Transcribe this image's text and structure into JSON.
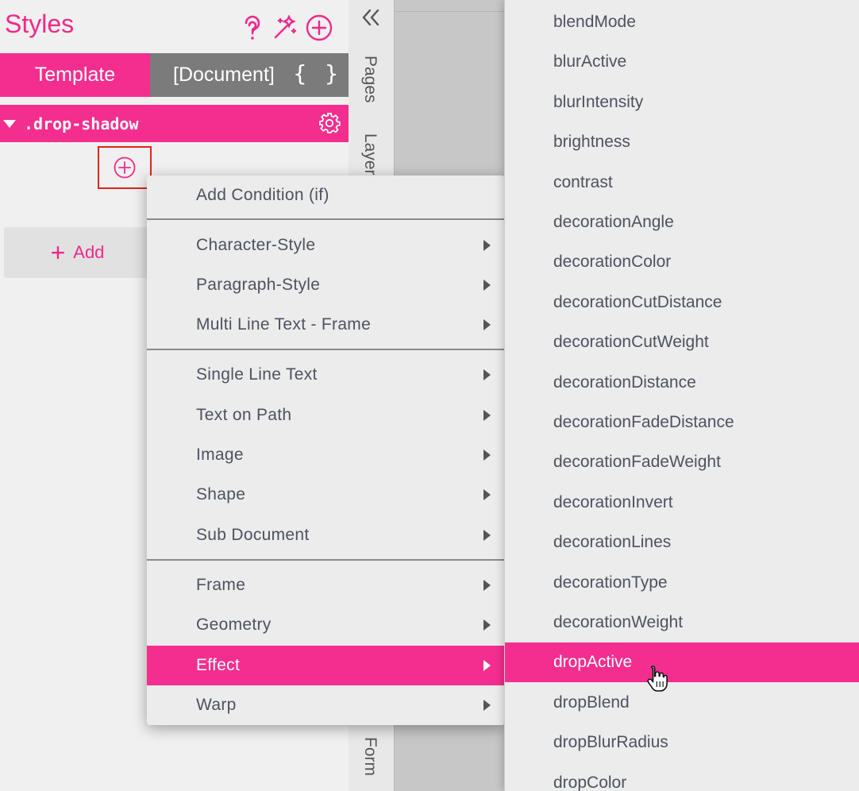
{
  "panel": {
    "title": "Styles",
    "header_icons": [
      "help-icon",
      "magic-wand-icon",
      "add-circle-icon"
    ],
    "tabs": [
      {
        "label": "Template",
        "active": true
      },
      {
        "label": "[Document]",
        "active": false
      }
    ],
    "braces_label": "{ }",
    "style_name": ".drop-shadow",
    "add_label": "Add"
  },
  "side_tabs": [
    "Pages",
    "Layers",
    "Form"
  ],
  "context_menu": {
    "items": [
      {
        "label": "Add Condition (if)",
        "submenu": false
      },
      {
        "label": "Character-Style",
        "submenu": true
      },
      {
        "label": "Paragraph-Style",
        "submenu": true
      },
      {
        "label": "Multi Line Text - Frame",
        "submenu": true
      },
      {
        "label": "Single Line Text",
        "submenu": true
      },
      {
        "label": "Text on Path",
        "submenu": true
      },
      {
        "label": "Image",
        "submenu": true
      },
      {
        "label": "Shape",
        "submenu": true
      },
      {
        "label": "Sub Document",
        "submenu": true
      },
      {
        "label": "Frame",
        "submenu": true
      },
      {
        "label": "Geometry",
        "submenu": true
      },
      {
        "label": "Effect",
        "submenu": true,
        "active": true
      },
      {
        "label": "Warp",
        "submenu": true
      }
    ]
  },
  "submenu": {
    "items": [
      "blendMode",
      "blurActive",
      "blurIntensity",
      "brightness",
      "contrast",
      "decorationAngle",
      "decorationColor",
      "decorationCutDistance",
      "decorationCutWeight",
      "decorationDistance",
      "decorationFadeDistance",
      "decorationFadeWeight",
      "decorationInvert",
      "decorationLines",
      "decorationType",
      "decorationWeight",
      "dropActive",
      "dropBlend",
      "dropBlurRadius",
      "dropColor"
    ],
    "active": "dropActive"
  },
  "colors": {
    "accent": "#f42e8e",
    "tab_inactive": "#7b7b7b",
    "highlight_box": "#e2231e"
  }
}
